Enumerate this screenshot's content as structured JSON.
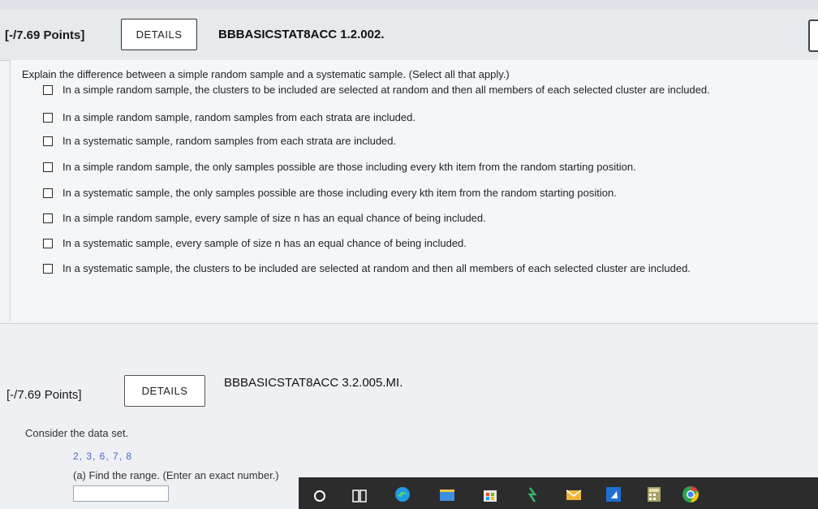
{
  "question1": {
    "points": "[-/7.69 Points]",
    "details_label": "DETAILS",
    "code": "BBBASICSTAT8ACC 1.2.002.",
    "prompt": "Explain the difference between a simple random sample and a systematic sample. (Select all that apply.)",
    "options": [
      "In a simple random sample, the clusters to be included are selected at random and then all members of each selected cluster are included.",
      "In a simple random sample, random samples from each strata are included.",
      "In a systematic sample, random samples from each strata are included.",
      "In a simple random sample, the only samples possible are those including every kth item from the random starting position.",
      "In a systematic sample, the only samples possible are those including every kth item from the random starting position.",
      "In a simple random sample, every sample of size n has an equal chance of being included.",
      "In a systematic sample, every sample of size n has an equal chance of being included.",
      "In a systematic sample, the clusters to be included are selected at random and then all members of each selected cluster are included."
    ]
  },
  "question2": {
    "points": "[-/7.69 Points]",
    "details_label": "DETAILS",
    "code": "BBBASICSTAT8ACC 3.2.005.MI.",
    "prompt": "Consider the data set.",
    "dataset": "2, 3, 6, 7, 8",
    "part_a": "(a) Find the range. (Enter an exact number.)"
  },
  "taskbar": {
    "icons": [
      "search-icon",
      "task-view-icon",
      "edge-icon",
      "file-explorer-icon",
      "store-icon",
      "app-icon",
      "mail-icon",
      "app-icon",
      "calculator-icon",
      "chrome-icon"
    ]
  },
  "colors": {
    "dataset_blue": "#4a66c8",
    "taskbar": "#2c2c2c"
  }
}
